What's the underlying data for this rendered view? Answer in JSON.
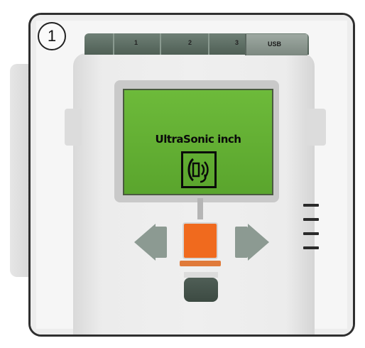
{
  "step": {
    "number": "1"
  },
  "brick": {
    "ports": [
      "1",
      "2",
      "3"
    ],
    "usb_label": "USB",
    "screen": {
      "text": "UltraSonic inch",
      "icon": "ultrasonic-sensor-icon",
      "color": "#6dba3a"
    },
    "buttons": {
      "left": "left-arrow-button",
      "center": "enter-button",
      "right": "right-arrow-button",
      "back": "back-button",
      "center_color": "#f06a1e",
      "arrow_color": "#8c9a92"
    }
  }
}
